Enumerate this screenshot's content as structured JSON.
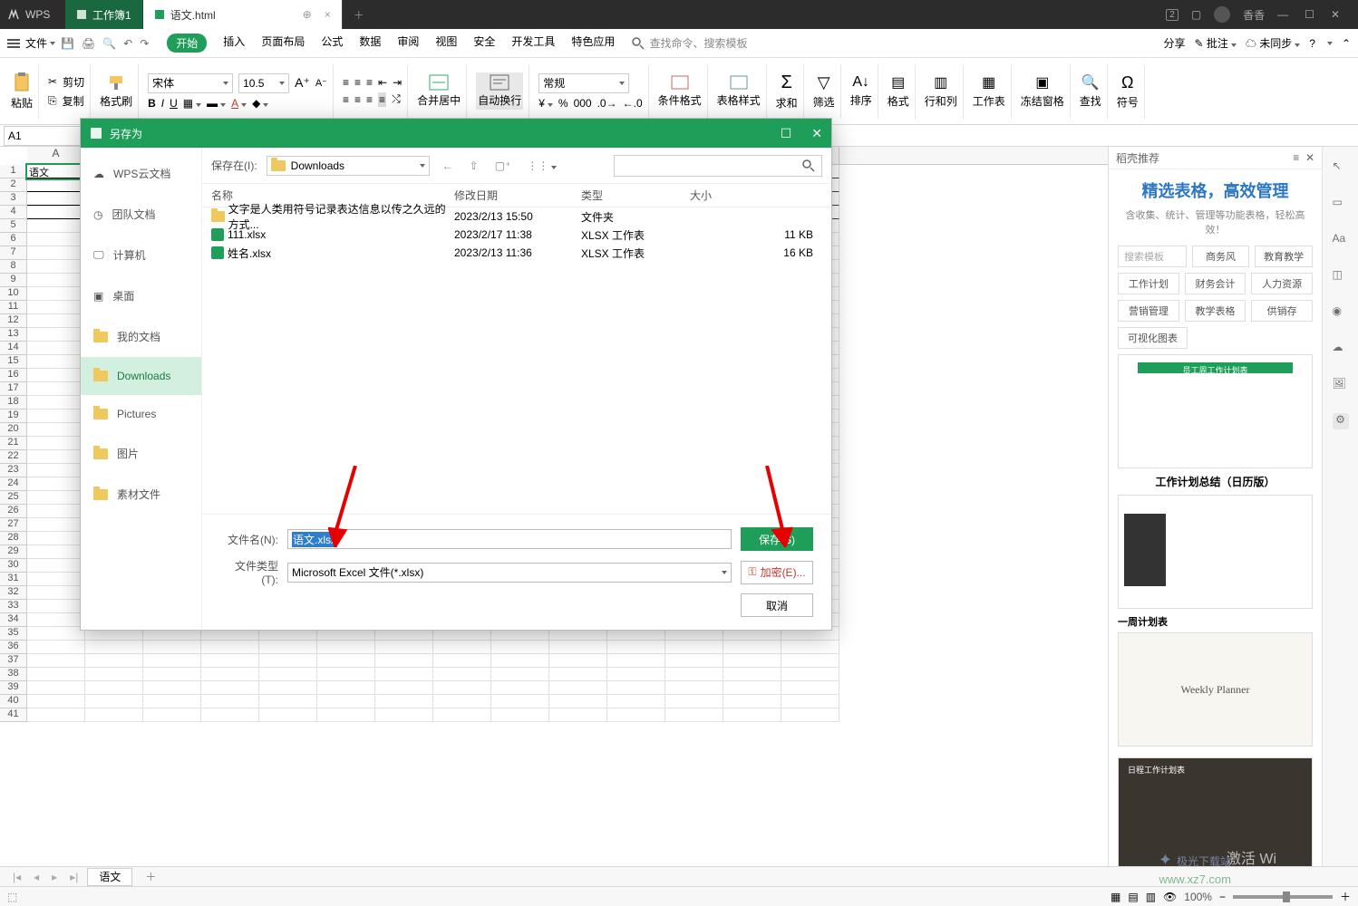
{
  "title_tabs": {
    "wps": "WPS",
    "wb1": "工作簿1",
    "active": "语文.html"
  },
  "user": "香香",
  "menu": {
    "file": "文件"
  },
  "ribbon_tabs": [
    "开始",
    "插入",
    "页面布局",
    "公式",
    "数据",
    "审阅",
    "视图",
    "安全",
    "开发工具",
    "特色应用"
  ],
  "search_hint": "查找命令、搜索模板",
  "share": "分享",
  "annotate": "批注",
  "sync": "未同步",
  "paste": "粘贴",
  "cut": "剪切",
  "copy": "复制",
  "painter": "格式刷",
  "font_name": "宋体",
  "font_size": "10.5",
  "merge": "合并居中",
  "wrap": "自动换行",
  "numfmt": "常规",
  "cond": "条件格式",
  "style": "表格样式",
  "sum": "求和",
  "filter": "筛选",
  "sort": "排序",
  "format": "格式",
  "rowcol": "行和列",
  "worksheet": "工作表",
  "freeze": "冻结窗格",
  "find": "查找",
  "symbol": "符号",
  "cell_ref": "A1",
  "cellA1": "语文",
  "sheet_tab": "语文",
  "zoom": "100%",
  "sidepanel": {
    "header": "稻壳推荐",
    "title": "精选表格，高效管理",
    "sub": "含收集、统计、管理等功能表格，轻松高效！",
    "chips1": [
      "商务风",
      "教育教学"
    ],
    "chips_placeholder": "搜索模板",
    "chips2": [
      "工作计划",
      "财务会计",
      "人力资源"
    ],
    "chips3": [
      "营销管理",
      "教学表格",
      "供销存"
    ],
    "chips4": "可视化图表",
    "thumb_titles": [
      "员工周工作计划表",
      "工作计划总结（日历版）",
      "一周计划表",
      "日程工作计划表"
    ],
    "weekly": "Weekly  Planner"
  },
  "dialog": {
    "title": "另存为",
    "side": {
      "cloud": "WPS云文档",
      "team": "团队文档",
      "computer": "计算机",
      "desktop": "桌面",
      "mydocs": "我的文档",
      "downloads": "Downloads",
      "pictures": "Pictures",
      "pics_cn": "图片",
      "assets": "素材文件"
    },
    "save_in": "保存在(I):",
    "loc": "Downloads",
    "cols": {
      "name": "名称",
      "date": "修改日期",
      "type": "类型",
      "size": "大小"
    },
    "files": [
      {
        "name": "文字是人类用符号记录表达信息以传之久远的方式...",
        "date": "2023/2/13 15:50",
        "type": "文件夹",
        "size": "",
        "icon": "folder"
      },
      {
        "name": "111.xlsx",
        "date": "2023/2/17 11:38",
        "type": "XLSX 工作表",
        "size": "11 KB",
        "icon": "xlsx"
      },
      {
        "name": "姓名.xlsx",
        "date": "2023/2/13 11:36",
        "type": "XLSX 工作表",
        "size": "16 KB",
        "icon": "xlsx"
      }
    ],
    "fname_lbl": "文件名(N):",
    "fname_val": "语文.xlsx",
    "ftype_lbl": "文件类型(T):",
    "ftype_val": "Microsoft Excel 文件(*.xlsx)",
    "save_btn": "保存(S)",
    "encrypt_btn": "加密(E)...",
    "cancel_btn": "取消"
  },
  "brand1": "极光下载站",
  "brand2": "www.xz7.com",
  "activate": "激活 Wi"
}
